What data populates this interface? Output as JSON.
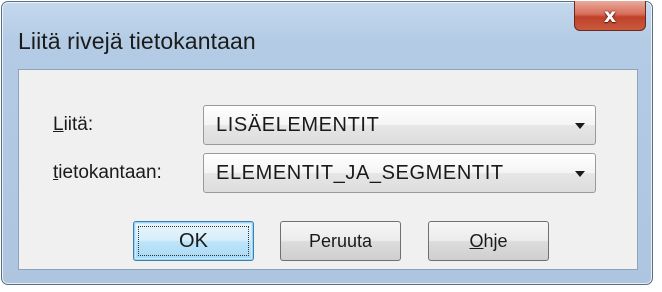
{
  "window": {
    "title": "Liitä rivejä tietokantaan",
    "close_label": "x"
  },
  "form": {
    "source": {
      "label_first": "L",
      "label_rest": "iitä:",
      "value": "LISÄELEMENTIT"
    },
    "target": {
      "label_first": "t",
      "label_rest": "ietokantaan:",
      "value": "ELEMENTIT_JA_SEGMENTIT"
    }
  },
  "buttons": {
    "ok": "OK",
    "cancel": "Peruuta",
    "help_first": "O",
    "help_rest": "hje"
  }
}
